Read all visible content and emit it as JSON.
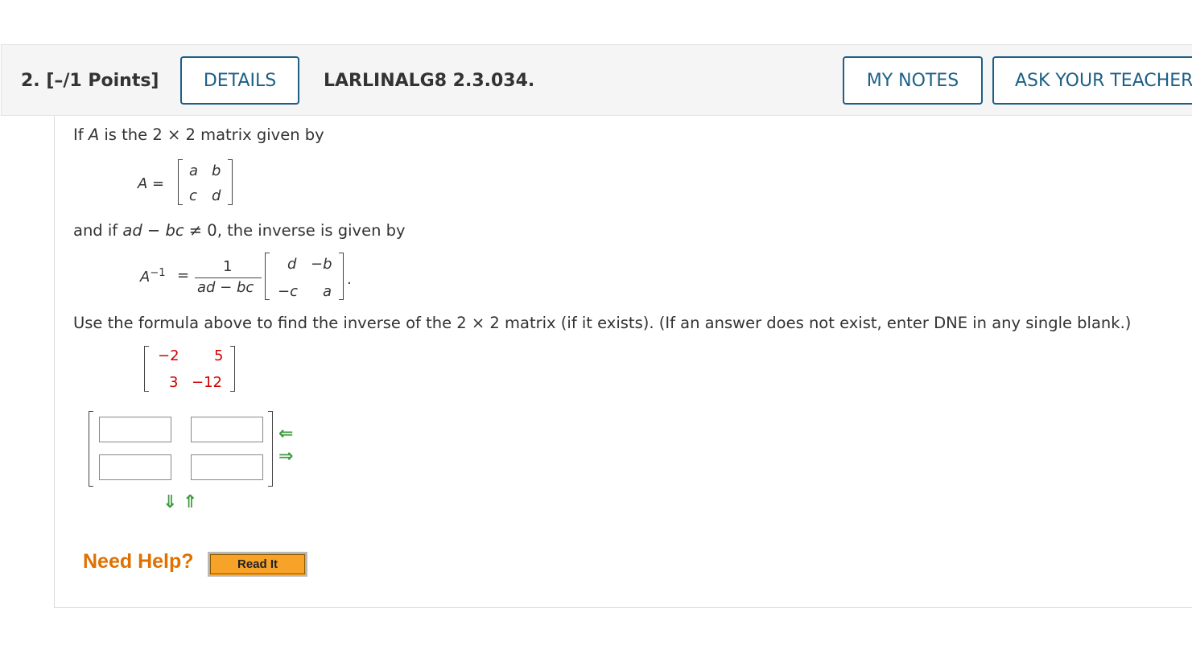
{
  "header": {
    "question_label": "2.  [–/1 Points]",
    "details_label": "DETAILS",
    "problem_code": "LARLINALG8 2.3.034.",
    "my_notes_label": "MY NOTES",
    "ask_teacher_label": "ASK YOUR TEACHER"
  },
  "problem": {
    "intro_1": "If ",
    "intro_var": "A",
    "intro_2": " is the 2 × 2 matrix given by",
    "matrix_A": {
      "lhs": "A =",
      "cells": [
        "a",
        "b",
        "c",
        "d"
      ]
    },
    "cond_1": "and if ",
    "cond_ad": "ad",
    "cond_minus": " − ",
    "cond_bc": "bc",
    "cond_2": " ≠ 0, the inverse is given by",
    "inverse": {
      "lhs_base": "A",
      "lhs_exp": "−1",
      "equals": "=",
      "numerator": "1",
      "denominator": "ad − bc",
      "cells": [
        "d",
        "−b",
        "−c",
        "a"
      ],
      "period": "."
    },
    "instruction": "Use the formula above to find the inverse of the 2 × 2 matrix (if it exists). (If an answer does not exist, enter DNE in any single blank.)",
    "given_matrix": [
      "−2",
      "5",
      "3",
      "−12"
    ],
    "answer_values": [
      "",
      "",
      "",
      ""
    ]
  },
  "help": {
    "need_help": "Need Help?",
    "read_it": "Read It"
  },
  "colors": {
    "accent": "#1d5f86",
    "matrix_red": "#d10000",
    "arrow_green": "#3f9b3f",
    "help_orange": "#e07000",
    "button_orange": "#f7a32a"
  }
}
